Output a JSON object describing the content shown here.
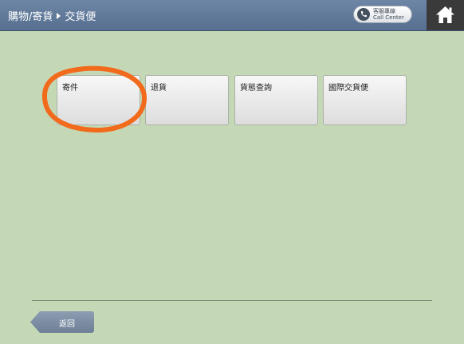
{
  "header": {
    "breadcrumb": [
      "購物/寄貨",
      "交貨便"
    ],
    "call_center": {
      "line1": "客服專線",
      "line2": "Call Center",
      "icon": "phone-icon"
    },
    "home_icon": "home-icon"
  },
  "tiles": [
    {
      "label": "寄件",
      "highlighted": true
    },
    {
      "label": "退貨"
    },
    {
      "label": "貨態查詢"
    },
    {
      "label": "國際交貨便"
    }
  ],
  "footer": {
    "back_label": "返回"
  },
  "colors": {
    "background": "#c5d8b6",
    "header": "#5d7596",
    "highlight": "#f26a1b",
    "home_bg": "#3a3a3a"
  }
}
